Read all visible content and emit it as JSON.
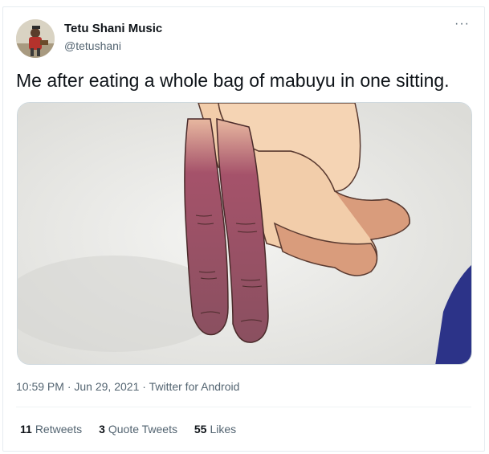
{
  "tweet": {
    "display_name": "Tetu Shani Music",
    "handle": "@tetushani",
    "more_icon": "···",
    "text": "Me after eating a whole bag of mabuyu in one sitting.",
    "time": "10:59 PM",
    "separator": " · ",
    "date": "Jun 29, 2021",
    "source": "Twitter for Android"
  },
  "stats": {
    "retweets_count": "11",
    "retweets_label": "Retweets",
    "quotes_count": "3",
    "quotes_label": "Quote Tweets",
    "likes_count": "55",
    "likes_label": "Likes"
  },
  "colors": {
    "text_primary": "#0f1419",
    "text_secondary": "#536471",
    "border": "#e6ecf0",
    "skin": "#f2cdaa",
    "finger_stain": "#9d4f60"
  }
}
